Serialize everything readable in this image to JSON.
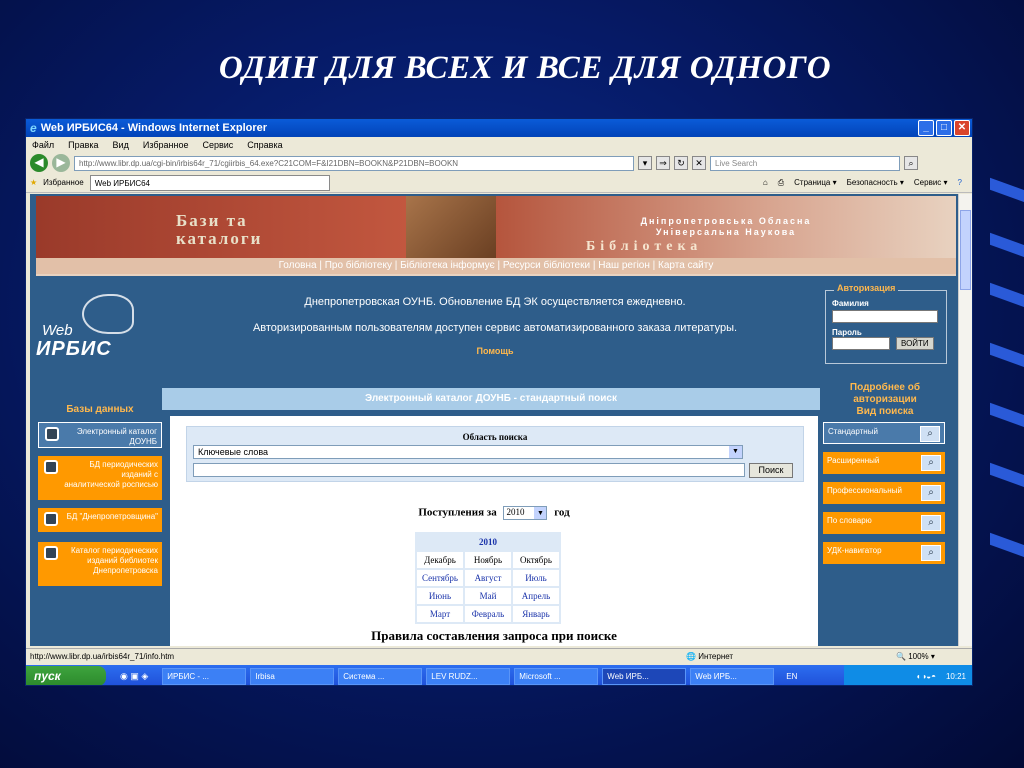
{
  "slide": {
    "title": "ОДИН ДЛЯ ВСЕХ И ВСЕ ДЛЯ ОДНОГО"
  },
  "window": {
    "title": "Web ИРБИС64 - Windows Internet Explorer",
    "menu": [
      "Файл",
      "Правка",
      "Вид",
      "Избранное",
      "Сервис",
      "Справка"
    ],
    "address": "http://www.libr.dp.ua/cgi-bin/irbis64r_71/cgiirbis_64.exe?C21COM=F&I21DBN=BOOKN&P21DBN=BOOKN",
    "search_placeholder": "Live Search",
    "favorites": "Избранное",
    "tab_title": "Web ИРБИС64",
    "toolbar": [
      "Страница ▾",
      "Безопасность ▾",
      "Сервис ▾"
    ]
  },
  "page": {
    "banner": {
      "title": "Бази та\nкаталоги",
      "org": "Дніпропетровська Обласна Універсальна Наукова",
      "library": "Бібліотека",
      "nav": "Головна | Про бібліотеку | Бібліотека інформує | Ресурси бібліотеки | Наш регіон | Карта сайту"
    },
    "logo": {
      "web": "Web",
      "irbis": "ИРБИС"
    },
    "info1": "Днепропетровская ОУНБ. Обновление БД ЭК осуществляется ежедневно.",
    "info2": "Авторизированным пользователям доступен сервис автоматизированного заказа литературы.",
    "help": "Помощь",
    "auth": {
      "legend": "Авторизация",
      "surname": "Фамилия",
      "password": "Пароль",
      "login": "ВОЙТИ",
      "more": "Подробнее об авторизации"
    },
    "search_header": "Электронный каталог ДОУНБ - стандартный поиск",
    "databases_title": "Базы данных",
    "databases": [
      "Электронный каталог ДОУНБ",
      "БД периодических изданий с аналитической росписью",
      "БД \"Днепропетровщина\"",
      "Каталог периодических изданий библиотек Днепропетровска"
    ],
    "search_types_title": "Вид поиска",
    "search_types": [
      "Стандартный",
      "Расширенный",
      "Профессиональный",
      "По словарю",
      "УДК-навигатор"
    ],
    "search_area": {
      "label": "Область поиска",
      "selected": "Ключевые слова",
      "button": "Поиск"
    },
    "arrivals": {
      "prefix": "Поступления за",
      "year": "2010",
      "suffix": "год"
    },
    "calendar": {
      "year": "2010",
      "rows": [
        [
          "Декабрь",
          "Ноябрь",
          "Октябрь"
        ],
        [
          "Сентябрь",
          "Август",
          "Июль"
        ],
        [
          "Июнь",
          "Май",
          "Апрель"
        ],
        [
          "Март",
          "Февраль",
          "Январь"
        ]
      ]
    },
    "rules": "Правила составления запроса при поиске"
  },
  "status": {
    "url": "http://www.libr.dp.ua/irbis64r_71/info.htm",
    "zone": "Интернет",
    "zoom": "100%"
  },
  "taskbar": {
    "start": "пуск",
    "items": [
      "ИРБИС - ...",
      "Irbisa",
      "Система ...",
      "LEV RUDZ...",
      "Microsoft ...",
      "Web ИРБ...",
      "Web ИРБ..."
    ],
    "lang": "EN",
    "clock": "10:21"
  }
}
